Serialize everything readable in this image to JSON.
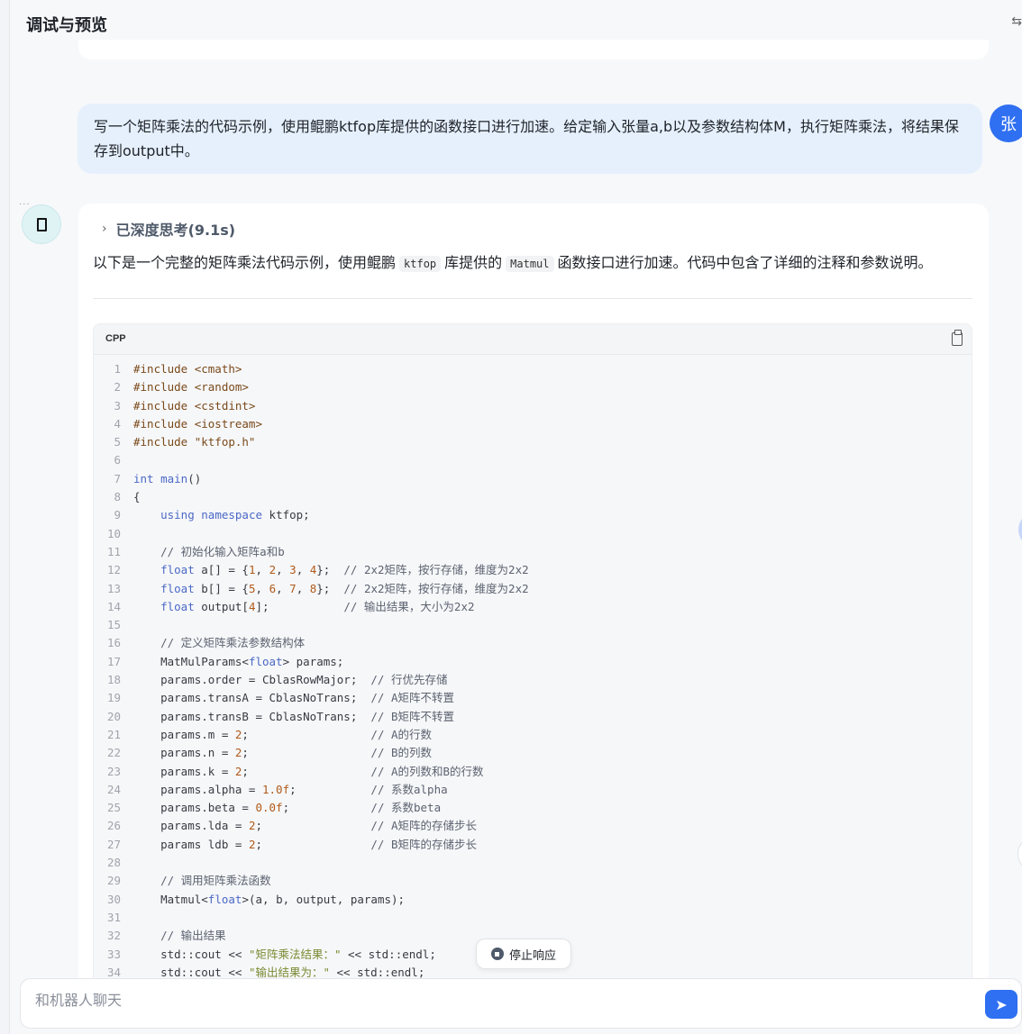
{
  "header": {
    "title": "调试与预览"
  },
  "user_message": {
    "text": "写一个矩阵乘法的代码示例，使用鲲鹏ktfop库提供的函数接口进行加速。给定输入张量a,b以及参数结构体M，执行矩阵乘法，将结果保存到output中。",
    "avatar": "张"
  },
  "bot_message": {
    "thinking_label": "已深度思考(9.1s)",
    "intro_before": "以下是一个完整的矩阵乘法代码示例，使用鲲鹏",
    "intro_code1": "ktfop",
    "intro_mid": "库提供的",
    "intro_code2": "Matmul",
    "intro_after": "函数接口进行加速。代码中包含了详细的注释和参数说明。",
    "code_lang": "CPP",
    "code_lines": [
      "#include <cmath>",
      "#include <random>",
      "#include <cstdint>",
      "#include <iostream>",
      "#include \"ktfop.h\"",
      "",
      "int main()",
      "{",
      "    using namespace ktfop;",
      "",
      "    // 初始化输入矩阵a和b",
      "    float a[] = {1, 2, 3, 4};  // 2x2矩阵，按行存储，维度为2x2",
      "    float b[] = {5, 6, 7, 8};  // 2x2矩阵，按行存储，维度为2x2",
      "    float output[4];           // 输出结果，大小为2x2",
      "",
      "    // 定义矩阵乘法参数结构体",
      "    MatMulParams<float> params;",
      "    params.order = CblasRowMajor;  // 行优先存储",
      "    params.transA = CblasNoTrans;  // A矩阵不转置",
      "    params.transB = CblasNoTrans;  // B矩阵不转置",
      "    params.m = 2;                  // A的行数",
      "    params.n = 2;                  // B的列数",
      "    params.k = 2;                  // A的列数和B的行数",
      "    params.alpha = 1.0f;           // 系数alpha",
      "    params.beta = 0.0f;            // 系数beta",
      "    params.lda = 2;                // A矩阵的存储步长",
      "    params ldb = 2;                // B矩阵的存储步长",
      "",
      "    // 调用矩阵乘法函数",
      "    Matmul<float>(a, b, output, params);",
      "",
      "    // 输出结果",
      "    std::cout << \"矩阵乘法结果：\" << std::endl;",
      "    std::cout << \"输出结果为：\" << std::endl;"
    ]
  },
  "stop_button": {
    "label": "停止响应"
  },
  "chat_input": {
    "placeholder": "和机器人聊天"
  },
  "colors": {
    "accent": "#2f6ff1",
    "user_bubble": "#e6f0fd"
  }
}
